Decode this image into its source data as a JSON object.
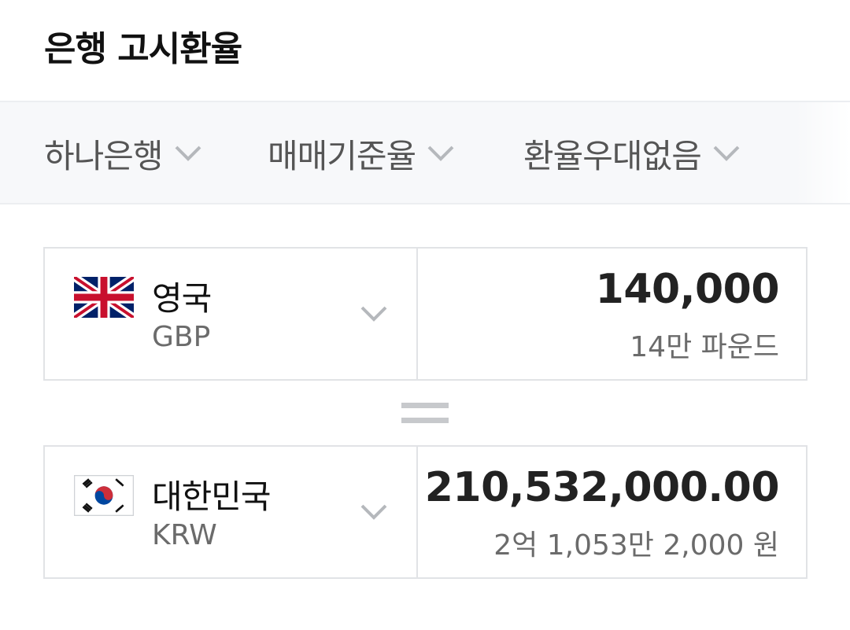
{
  "header": {
    "title": "은행 고시환율"
  },
  "filters": [
    {
      "label": "하나은행"
    },
    {
      "label": "매매기준율"
    },
    {
      "label": "환율우대없음"
    }
  ],
  "from": {
    "country": "영국",
    "code": "GBP",
    "flag_icon": "uk-flag-icon",
    "amount": "140,000",
    "amount_words": "14만 파운드"
  },
  "to": {
    "country": "대한민국",
    "code": "KRW",
    "flag_icon": "korea-flag-icon",
    "amount": "210,532,000.00",
    "amount_words": "2억 1,053만 2,000 원"
  },
  "colors": {
    "filter_bg": "#f7f8fa",
    "border": "#e1e3e6",
    "muted_text": "#6b6b6b",
    "equals": "#c7c9cc"
  }
}
